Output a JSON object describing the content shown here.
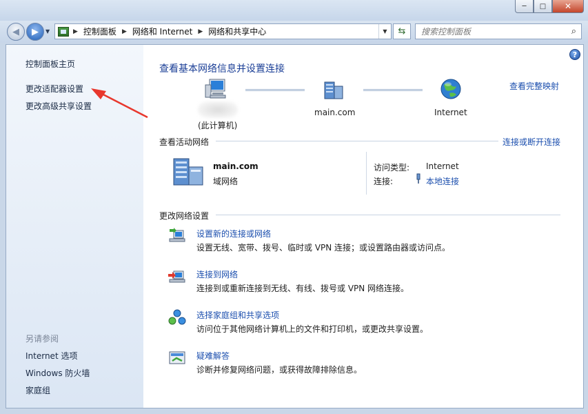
{
  "window": {
    "controls": {
      "minimize": "─",
      "maximize": "□",
      "close": "✕"
    }
  },
  "nav": {
    "breadcrumbs": [
      "控制面板",
      "网络和 Internet",
      "网络和共享中心"
    ],
    "search_placeholder": "搜索控制面板"
  },
  "sidebar": {
    "items": [
      {
        "label": "控制面板主页"
      },
      {
        "label": "更改适配器设置"
      },
      {
        "label": "更改高级共享设置"
      }
    ],
    "see_also_title": "另请参阅",
    "see_also": [
      {
        "label": "Internet 选项"
      },
      {
        "label": "Windows 防火墙"
      },
      {
        "label": "家庭组"
      }
    ]
  },
  "main": {
    "title": "查看基本网络信息并设置连接",
    "map_link": "查看完整映射",
    "nodes": [
      {
        "label": "(此计算机)"
      },
      {
        "label": "main.com"
      },
      {
        "label": "Internet"
      }
    ],
    "active_networks_title": "查看活动网络",
    "connect_link": "连接或断开连接",
    "active_network": {
      "name": "main.com",
      "type": "域网络",
      "access_type_label": "访问类型:",
      "access_type_value": "Internet",
      "connection_label": "连接:",
      "connection_value": "本地连接"
    },
    "change_settings_title": "更改网络设置",
    "tasks": [
      {
        "link": "设置新的连接或网络",
        "desc": "设置无线、宽带、拨号、临时或 VPN 连接；或设置路由器或访问点。"
      },
      {
        "link": "连接到网络",
        "desc": "连接到或重新连接到无线、有线、拨号或 VPN 网络连接。"
      },
      {
        "link": "选择家庭组和共享选项",
        "desc": "访问位于其他网络计算机上的文件和打印机，或更改共享设置。"
      },
      {
        "link": "疑难解答",
        "desc": "诊断并修复网络问题，或获得故障排除信息。"
      }
    ]
  },
  "colors": {
    "link": "#1c4fae",
    "title": "#1a3e96",
    "annotation_arrow": "#e8372d"
  }
}
